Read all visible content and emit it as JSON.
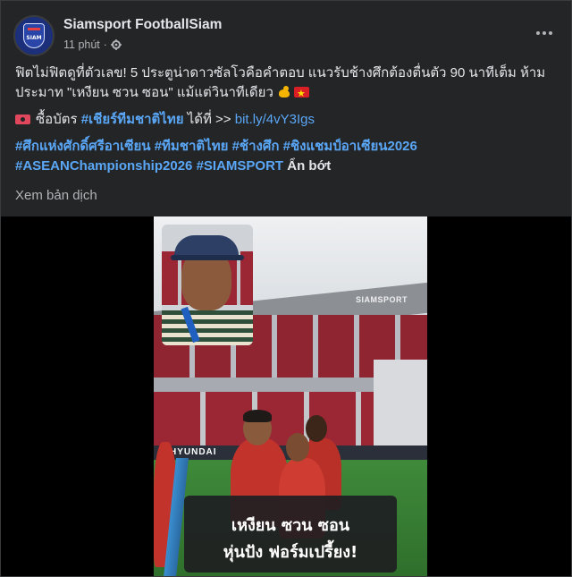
{
  "header": {
    "page_name": "Siamsport FootballSiam",
    "avatar_label": "SIAM",
    "time_ago": "11 phút",
    "separator": "·"
  },
  "post": {
    "line1": "ฟิตไม่ฟิตดูที่ตัวเลข! 5 ประตูน่าดาวซัลโวคือคำตอบ แนวรับช้างศึกต้องตื่นตัว 90 นาทีเต็ม ห้าม",
    "line2": "ประมาท \"เหงียน ซวน ซอน\" แม้แต่วินาทีเดียว",
    "ticket_prefix": "ซื้อบัตร",
    "ticket_hashtag": "#เชียร์ทีมชาติไทย",
    "ticket_middle": "ได้ที่ >>",
    "ticket_link": "bit.ly/4vY3Igs",
    "hashtags_line1": [
      "#ศึกแห่งศักดิ์ศรีอาเซียน",
      "#ทีมชาติไทย",
      "#ช้างศึก",
      "#ชิงแชมป์อาเซียน2026"
    ],
    "hashtags_line2": [
      "#ASEANChampionship2026",
      "#SIAMSPORT"
    ],
    "see_less": "Ẩn bớt",
    "translate": "Xem bản dịch"
  },
  "video": {
    "watermark": "SIAMSPORT",
    "ad_board": "HYUNDAI",
    "caption_line1": "เหงียน ซวน ซอน",
    "caption_line2": "หุ่นปัง ฟอร์มเปรี้ยง!"
  },
  "colors": {
    "background": "#242526",
    "link": "#5aa7f7",
    "text": "#e4e6eb",
    "muted": "#b0b3b8"
  }
}
